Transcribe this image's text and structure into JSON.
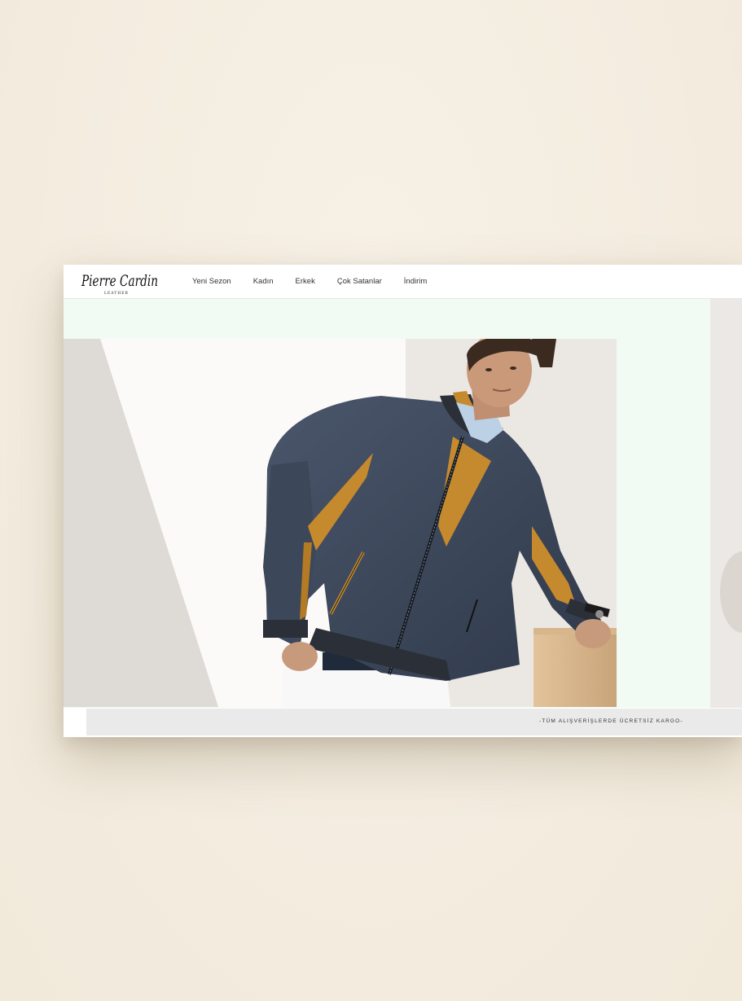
{
  "brand": {
    "logo_text": "Pierre Cardin",
    "logo_subtext": "LEATHER"
  },
  "nav": {
    "items": [
      {
        "label": "Yeni Sezon"
      },
      {
        "label": "Kadın"
      },
      {
        "label": "Erkek"
      },
      {
        "label": "Çok Satanlar"
      },
      {
        "label": "İndirim"
      }
    ]
  },
  "hero": {
    "image_subject": "man-in-navy-leather-jacket"
  },
  "announcement": {
    "text": "-TÜM ALIŞVERİŞLERDE ÜCRETSİZ KARGO-"
  },
  "colors": {
    "page_background": "#f5efe3",
    "hero_background": "#f1fbf3",
    "jacket_navy": "#3e4a5e",
    "jacket_accent": "#c68a2e",
    "announcement_bg": "#eaeaea"
  }
}
